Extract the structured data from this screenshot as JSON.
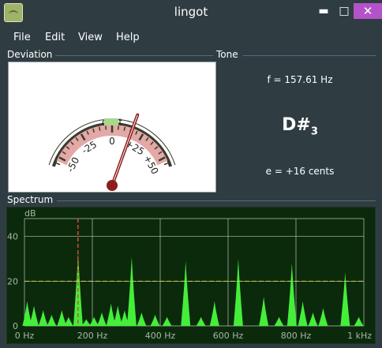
{
  "window": {
    "title": "lingot",
    "minimize_glyph": "▬",
    "maximize_glyph": "□",
    "close_glyph": "✕"
  },
  "menu": {
    "items": [
      "File",
      "Edit",
      "View",
      "Help"
    ]
  },
  "deviation": {
    "label": "Deviation",
    "unit_label": "cent",
    "tick_labels": [
      "-50",
      "-25",
      "0",
      "+25",
      "+50"
    ],
    "needle_cents": 16,
    "colors": {
      "arc": "#3a3a2e",
      "band": "#e3a9a6",
      "ok_zone": "#a8d88c",
      "needle": "#8d1d1d"
    }
  },
  "tone": {
    "label": "Tone",
    "frequency": "f = 157.61 Hz",
    "note": "D#",
    "octave": "3",
    "error": "e = +16 cents"
  },
  "spectrum": {
    "label": "Spectrum",
    "y_unit": "dB",
    "y_ticks": [
      "40",
      "20",
      "0"
    ],
    "x_ticks": [
      "0 Hz",
      "200 Hz",
      "400 Hz",
      "600 Hz",
      "800 Hz",
      "1 kHz"
    ],
    "colors": {
      "background": "#0b2a0b",
      "fill": "#44ee3a",
      "grid": "#b9c2b9",
      "threshold": "#d7d24a",
      "marker": "#e2423a"
    }
  },
  "chart_data": {
    "type": "area",
    "xlabel": "",
    "ylabel": "dB",
    "xlim": [
      0,
      1000
    ],
    "ylim": [
      0,
      48
    ],
    "threshold_db": 20,
    "marker_hz": 157.61,
    "peaks": [
      {
        "x": 8,
        "y": 11
      },
      {
        "x": 28,
        "y": 9
      },
      {
        "x": 55,
        "y": 7
      },
      {
        "x": 80,
        "y": 5
      },
      {
        "x": 110,
        "y": 7
      },
      {
        "x": 130,
        "y": 4
      },
      {
        "x": 158,
        "y": 33
      },
      {
        "x": 182,
        "y": 3
      },
      {
        "x": 205,
        "y": 4
      },
      {
        "x": 228,
        "y": 6
      },
      {
        "x": 255,
        "y": 10
      },
      {
        "x": 275,
        "y": 9
      },
      {
        "x": 295,
        "y": 7
      },
      {
        "x": 316,
        "y": 31
      },
      {
        "x": 345,
        "y": 6
      },
      {
        "x": 385,
        "y": 5
      },
      {
        "x": 420,
        "y": 4
      },
      {
        "x": 475,
        "y": 29
      },
      {
        "x": 520,
        "y": 4
      },
      {
        "x": 560,
        "y": 11
      },
      {
        "x": 630,
        "y": 30
      },
      {
        "x": 705,
        "y": 13
      },
      {
        "x": 750,
        "y": 4
      },
      {
        "x": 788,
        "y": 28
      },
      {
        "x": 820,
        "y": 11
      },
      {
        "x": 850,
        "y": 6
      },
      {
        "x": 880,
        "y": 8
      },
      {
        "x": 945,
        "y": 24
      },
      {
        "x": 985,
        "y": 4
      }
    ]
  }
}
